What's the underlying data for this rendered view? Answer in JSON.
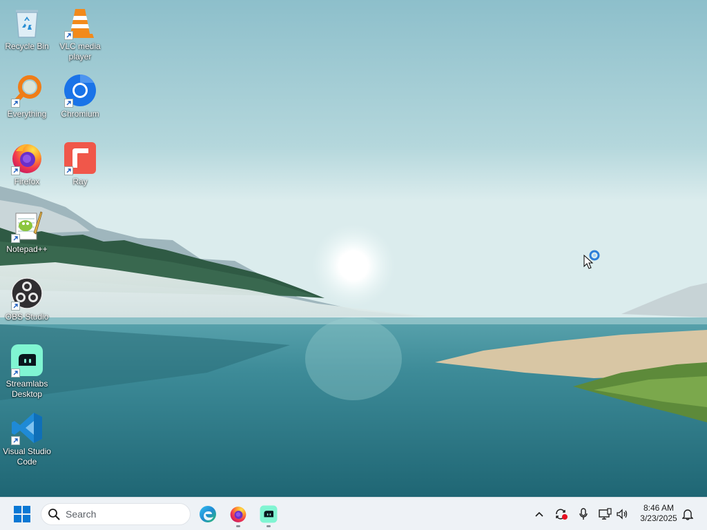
{
  "desktop": {
    "icons": [
      {
        "label": "Recycle Bin",
        "icon": "recycle-bin-icon",
        "shortcut": false
      },
      {
        "label": "VLC media player",
        "icon": "vlc-icon",
        "shortcut": true
      },
      {
        "label": "Everything",
        "icon": "everything-icon",
        "shortcut": true
      },
      {
        "label": "Chromium",
        "icon": "chromium-icon",
        "shortcut": true
      },
      {
        "label": "Firefox",
        "icon": "firefox-icon",
        "shortcut": true
      },
      {
        "label": "Ray",
        "icon": "ray-icon",
        "shortcut": true
      },
      {
        "label": "Notepad++",
        "icon": "notepadpp-icon",
        "shortcut": true
      },
      {
        "label": "OBS Studio",
        "icon": "obs-icon",
        "shortcut": true
      },
      {
        "label": "Streamlabs Desktop",
        "icon": "streamlabs-icon",
        "shortcut": true
      },
      {
        "label": "Visual Studio Code",
        "icon": "vscode-icon",
        "shortcut": true
      }
    ]
  },
  "taskbar": {
    "start_icon": "windows-start-icon",
    "search": {
      "placeholder": "Search",
      "icon": "search-icon"
    },
    "pinned": [
      {
        "name": "Microsoft Edge",
        "icon": "edge-icon",
        "running": false
      },
      {
        "name": "Firefox",
        "icon": "firefox-icon",
        "running": true
      },
      {
        "name": "Streamlabs Desktop",
        "icon": "streamlabs-icon",
        "running": true
      }
    ],
    "tray": {
      "icons": [
        "chevron-up-icon",
        "sync-recording-icon",
        "microphone-icon",
        "network-icon",
        "volume-icon",
        "notification-bell-icon"
      ],
      "time": "8:46 AM",
      "date": "3/23/2025"
    }
  },
  "colors": {
    "taskbar_bg": "#eef2f6",
    "windows_blue": "#0a78d4",
    "streamlabs_green": "#80f5d2",
    "vlc_orange": "#f28a1b",
    "ray_red": "#f0574a"
  }
}
